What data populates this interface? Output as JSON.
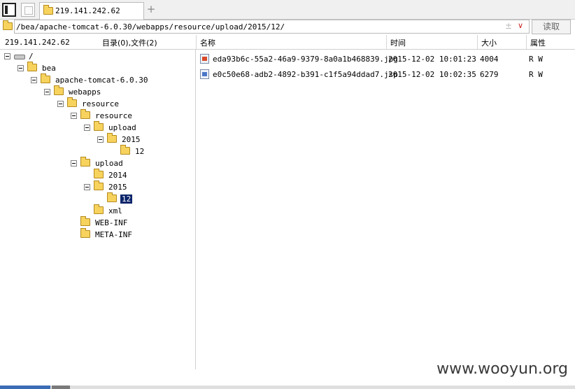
{
  "tab": {
    "title": "219.141.242.62",
    "add_label": "+"
  },
  "address": {
    "path": "/bea/apache-tomcat-6.0.30/webapps/resource/upload/2015/12/",
    "pm_glyph": "±",
    "chevron_glyph": "∨",
    "read_label": "读取"
  },
  "info": {
    "ip": "219.141.242.62",
    "stats": "目录(0),文件(2)"
  },
  "columns": {
    "name": "名称",
    "time": "时间",
    "size": "大小",
    "attr": "属性"
  },
  "tree": [
    {
      "label": "/",
      "icon": "drive-icon",
      "toggle": true
    },
    {
      "label": "bea",
      "icon": "folder-icon",
      "toggle": true
    },
    {
      "label": "apache-tomcat-6.0.30",
      "icon": "folder-icon",
      "toggle": true
    },
    {
      "label": "webapps",
      "icon": "folder-icon",
      "toggle": true
    },
    {
      "label": "resource",
      "icon": "folder-icon",
      "toggle": true
    },
    {
      "label": "resource",
      "icon": "folder-icon",
      "toggle": true
    },
    {
      "label": "upload",
      "icon": "folder-icon",
      "toggle": true
    },
    {
      "label": "2015",
      "icon": "folder-icon",
      "toggle": true
    },
    {
      "label": "12",
      "icon": "folder-icon",
      "toggle": false
    },
    {
      "label": "upload",
      "icon": "folder-icon",
      "toggle": true
    },
    {
      "label": "2014",
      "icon": "folder-icon",
      "toggle": false
    },
    {
      "label": "2015",
      "icon": "folder-icon",
      "toggle": true
    },
    {
      "label": "12",
      "icon": "folder-icon",
      "toggle": false,
      "selected": true
    },
    {
      "label": "xml",
      "icon": "folder-icon",
      "toggle": false
    },
    {
      "label": "WEB-INF",
      "icon": "folder-icon",
      "toggle": false
    },
    {
      "label": "META-INF",
      "icon": "folder-icon",
      "toggle": false
    }
  ],
  "files": [
    {
      "name": "eda93b6c-55a2-46a9-9379-8a0a1b468839.jpg",
      "time": "2015-12-02 10:01:23",
      "size": "4004",
      "attr": "R W",
      "icon": "image-file-icon"
    },
    {
      "name": "e0c50e68-adb2-4892-b391-c1f5a94ddad7.jsp",
      "time": "2015-12-02 10:02:35",
      "size": "6279",
      "attr": "R W",
      "icon": "script-file-icon"
    }
  ],
  "watermark": "www.wooyun.org"
}
